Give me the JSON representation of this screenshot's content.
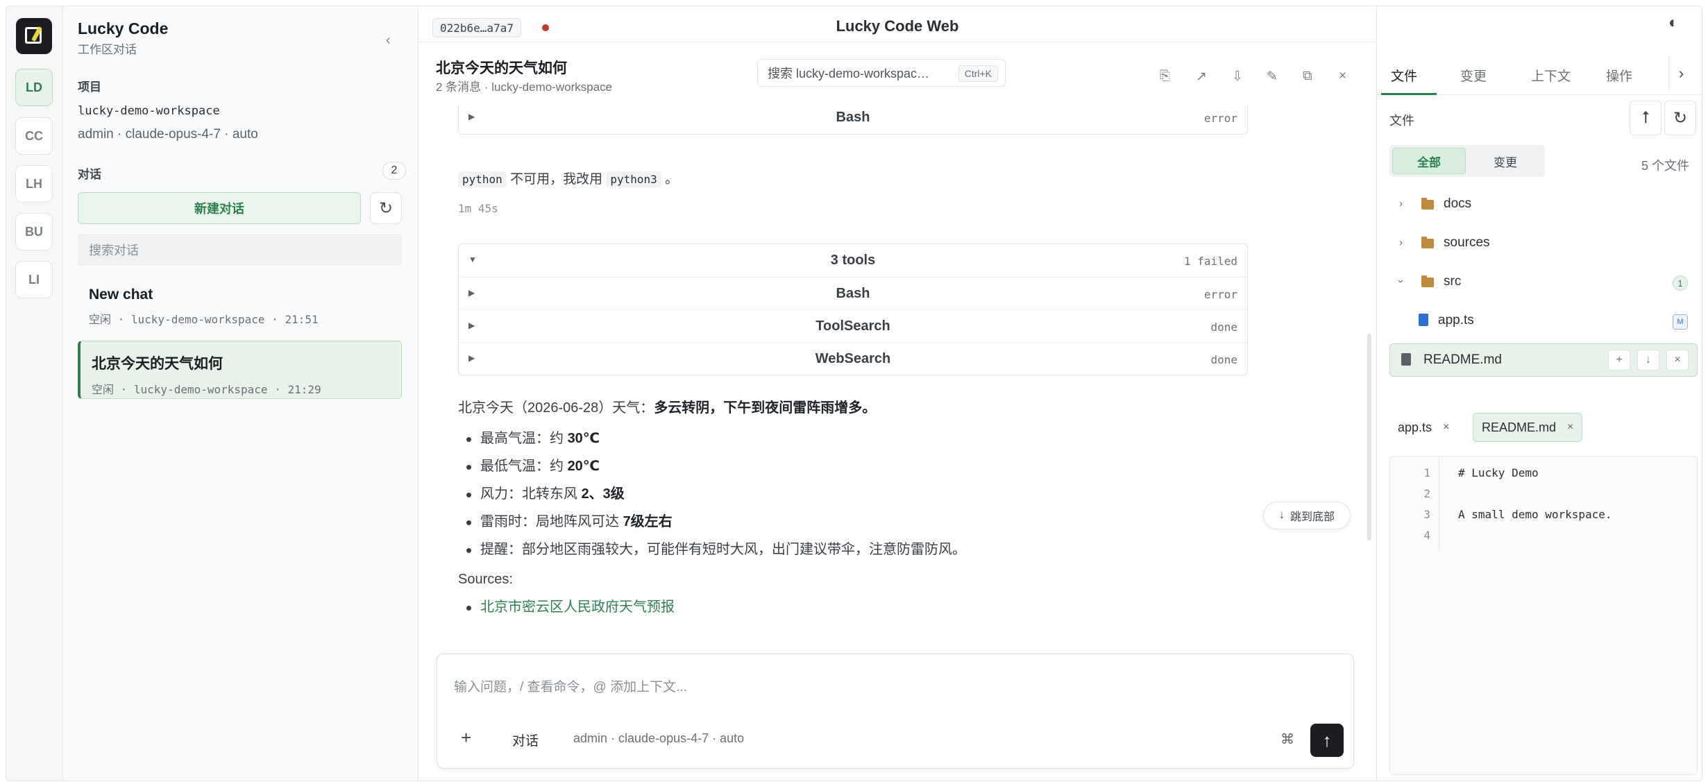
{
  "rail": {
    "items": [
      "LD",
      "CC",
      "LH",
      "BU",
      "LI"
    ]
  },
  "sidebar": {
    "title": "Lucky Code",
    "subtitle": "工作区对话",
    "collapse_icon": "chevron-left-icon",
    "project_label": "项目",
    "project_name": "lucky-demo-workspace",
    "project_meta": "admin · claude-opus-4-7 · auto",
    "chats_label": "对话",
    "chats_count": "2",
    "new_chat": "新建对话",
    "refresh_icon": "↻",
    "search_placeholder": "搜索对话",
    "chats": [
      {
        "title": "New chat",
        "meta": "空闲 · lucky-demo-workspace · 21:51"
      },
      {
        "title": "北京今天的天气如何",
        "meta": "空闲 · lucky-demo-workspace · 21:29"
      }
    ]
  },
  "header": {
    "session_hash": "022b6e…a7a7",
    "app_title": "Lucky Code Web",
    "conversation_title": "北京今天的天气如何",
    "conversation_sub": "2 条消息 · lucky-demo-workspace",
    "search_value": "搜索 lucky-demo-workspac…",
    "search_shortcut": "Ctrl+K",
    "toolbar_icons": [
      "copy-icon",
      "share-icon",
      "download-icon",
      "edit-icon",
      "duplicate-icon",
      "close-icon"
    ]
  },
  "messages": {
    "first_tool": {
      "name": "Bash",
      "status": "error"
    },
    "note_prefix_code": "python",
    "note_middle": "不可用，我改用",
    "note_code": "python3",
    "note_suffix": "。",
    "elapsed": "1m 45s",
    "tool_group": {
      "title": "3 tools",
      "summary": "1 failed",
      "tools": [
        {
          "name": "Bash",
          "status": "error"
        },
        {
          "name": "ToolSearch",
          "status": "done"
        },
        {
          "name": "WebSearch",
          "status": "done"
        }
      ]
    },
    "answer": {
      "intro": "北京今天（2026-06-28）天气：",
      "intro_bold": "多云转阴，下午到夜间雷阵雨增多。",
      "bullets": [
        {
          "label": "最高气温：约 ",
          "bold": "30℃"
        },
        {
          "label": "最低气温：约 ",
          "bold": "20℃"
        },
        {
          "label": "风力：北转东风 ",
          "bold": "2、3级"
        },
        {
          "label": "雷雨时：局地阵风可达 ",
          "bold": "7级左右"
        },
        {
          "label": "提醒：部分地区雨强较大，可能伴有短时大风，出门建议带伞，注意防雷防风。",
          "bold": ""
        }
      ],
      "sources_label": "Sources:",
      "source_link": "北京市密云区人民政府天气预报"
    },
    "jump_bottom": "跳到底部"
  },
  "composer": {
    "placeholder": "输入问题，/ 查看命令，@ 添加上下文...",
    "mode": "对话",
    "meta": "admin · claude-opus-4-7 · auto",
    "cmd_symbol": "⌘",
    "plus": "+",
    "send": "↑"
  },
  "right": {
    "theme_icon": "◐",
    "tabs": [
      "文件",
      "变更",
      "上下文",
      "操作"
    ],
    "next_icon": "›",
    "files_label": "文件",
    "up_icon": "⭡",
    "refresh_icon": "↻",
    "seg_all": "全部",
    "seg_changes": "变更",
    "file_count": "5 个文件",
    "tree": {
      "docs": "docs",
      "sources": "sources",
      "src": "src",
      "src_badge": "1",
      "app": "app.ts",
      "app_badge": "M",
      "readme": "README.md"
    },
    "open_tabs": [
      "app.ts",
      "README.md"
    ],
    "editor_lines": [
      {
        "n": "1",
        "text": "# Lucky Demo"
      },
      {
        "n": "2",
        "text": ""
      },
      {
        "n": "3",
        "text": "A small demo workspace."
      },
      {
        "n": "4",
        "text": ""
      }
    ]
  },
  "colors": {
    "accent": "#2e8050",
    "accent_bg": "#e7f3ea",
    "status_dot": "#c0392b"
  }
}
